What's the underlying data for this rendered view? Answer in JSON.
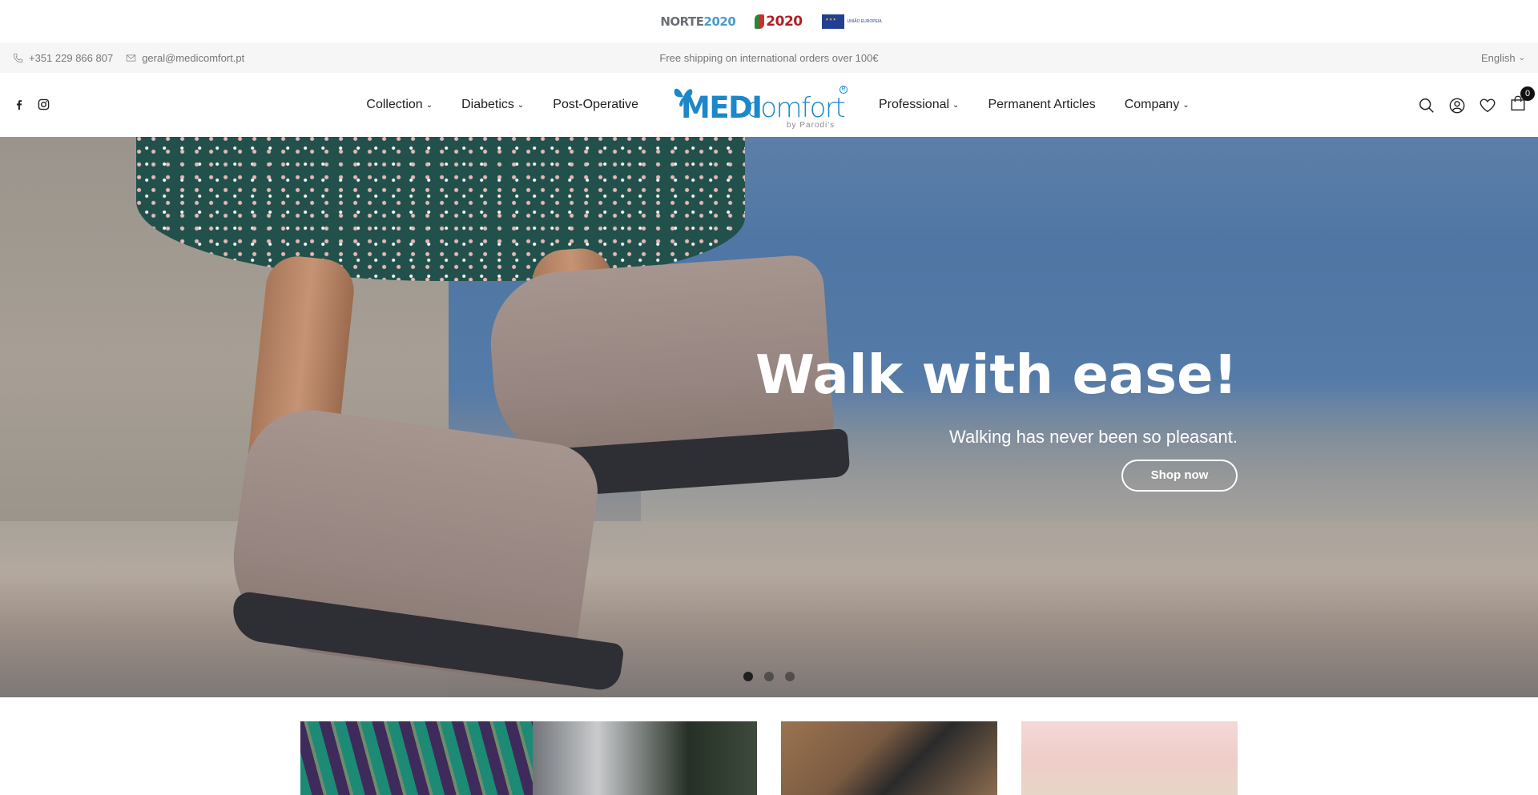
{
  "funding": {
    "norte_text": "NORTE",
    "norte_year": "2020",
    "pt_label": "PORTUGAL",
    "pt_year": "2020",
    "eu_text": "UNIÃO EUROPEIA"
  },
  "info_bar": {
    "phone": "+351 229 866 807",
    "email": "geral@medicomfort.pt",
    "promo": "Free shipping on international orders over 100€",
    "language": "English"
  },
  "nav": {
    "left": [
      {
        "label": "Collection",
        "dropdown": true
      },
      {
        "label": "Diabetics",
        "dropdown": true
      },
      {
        "label": "Post-Operative",
        "dropdown": false
      }
    ],
    "right": [
      {
        "label": "Professional",
        "dropdown": true
      },
      {
        "label": "Permanent Articles",
        "dropdown": false
      },
      {
        "label": "Company",
        "dropdown": true
      }
    ]
  },
  "brand": {
    "medi": "MEDI",
    "comfort": "comfort",
    "by": "by Parodi's",
    "reg": "R"
  },
  "cart": {
    "count": "0"
  },
  "hero": {
    "title": "Walk with ease!",
    "subtitle": "Walking has never been so pleasant.",
    "cta": "Shop now",
    "slides": 3,
    "active_slide": 1
  },
  "colors": {
    "brand_blue": "#1c87c9",
    "info_bar_bg": "#f6f6f6"
  }
}
